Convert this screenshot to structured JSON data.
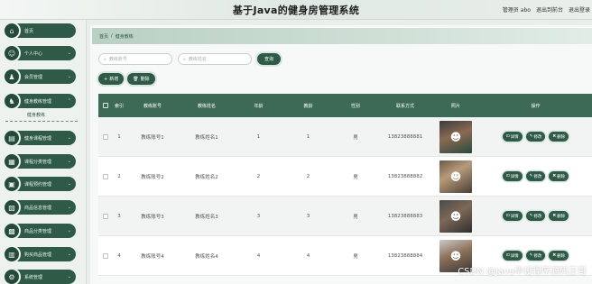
{
  "header": {
    "title": "基于Java的健身房管理系统",
    "links": [
      "管理员 abo",
      "退出到前台",
      "退出登录"
    ]
  },
  "sidebar": {
    "items": [
      {
        "label": "首页",
        "icon": "home-icon",
        "glyph": "⌂"
      },
      {
        "label": "个人中心",
        "icon": "user-icon",
        "glyph": "☺"
      },
      {
        "label": "会员管理",
        "icon": "users-icon",
        "glyph": "♟"
      },
      {
        "label": "健身教练管理",
        "icon": "coach-icon",
        "glyph": "♞"
      },
      {
        "label": "健身课程管理",
        "icon": "course-icon",
        "glyph": "▤"
      },
      {
        "label": "课程分类管理",
        "icon": "category-icon",
        "glyph": "▦"
      },
      {
        "label": "课程预约管理",
        "icon": "calendar-icon",
        "glyph": "▣"
      },
      {
        "label": "商品信息管理",
        "icon": "goods-icon",
        "glyph": "▧"
      },
      {
        "label": "商品分类管理",
        "icon": "tag-icon",
        "glyph": "▩"
      },
      {
        "label": "购买商品管理",
        "icon": "cart-icon",
        "glyph": "▥"
      },
      {
        "label": "系统管理",
        "icon": "settings-icon",
        "glyph": "⚙"
      }
    ],
    "active_sub": "健身教练"
  },
  "breadcrumb": {
    "home": "首页",
    "sep": "/",
    "current": "健身教练"
  },
  "search": {
    "account_placeholder": "教练账号",
    "name_placeholder": "教练姓名",
    "query_label": "查询"
  },
  "actions": {
    "add_label": "新增",
    "delete_label": "删除"
  },
  "table": {
    "columns": [
      "索引",
      "教练账号",
      "教练姓名",
      "年龄",
      "教龄",
      "性别",
      "联系方式",
      "照片",
      "操作"
    ],
    "rows": [
      {
        "idx": "1",
        "account": "教练账号1",
        "name": "教练姓名1",
        "age": "1",
        "years": "1",
        "sex": "男",
        "phone": "13823888881"
      },
      {
        "idx": "2",
        "account": "教练账号2",
        "name": "教练姓名2",
        "age": "2",
        "years": "2",
        "sex": "男",
        "phone": "13823888882"
      },
      {
        "idx": "3",
        "account": "教练账号3",
        "name": "教练姓名3",
        "age": "3",
        "years": "3",
        "sex": "男",
        "phone": "13823888883"
      },
      {
        "idx": "4",
        "account": "教练账号4",
        "name": "教练姓名4",
        "age": "4",
        "years": "4",
        "sex": "男",
        "phone": "13823888884"
      }
    ],
    "ops": {
      "detail": "详情",
      "edit": "修改",
      "delete": "删除"
    }
  },
  "colors": {
    "accent": "#2f5a48",
    "header_bg": "#3c6a56"
  },
  "watermark": "CSDN @Java毕设程序源码王哥"
}
